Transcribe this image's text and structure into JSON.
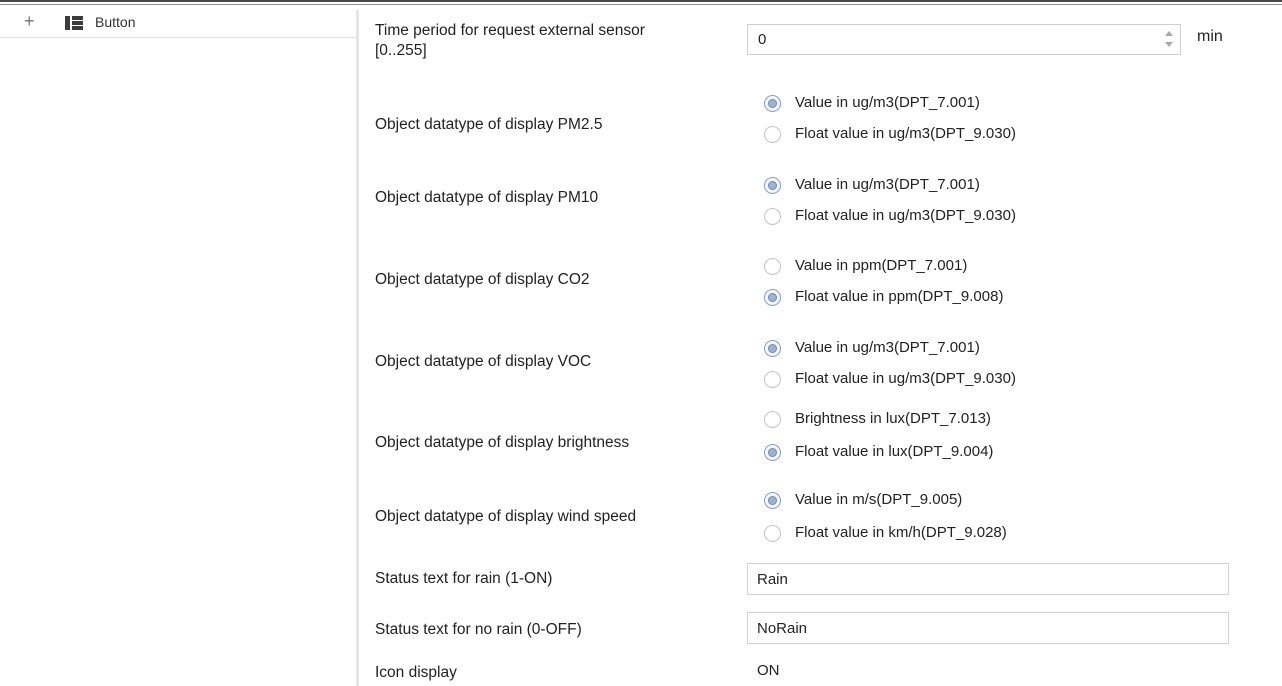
{
  "tree": {
    "expand_symbol": "+",
    "item_label": "Button",
    "item_icon": "panel-list-icon"
  },
  "request_period": {
    "label_line1": "Time period for request external sensor",
    "label_line2": "[0..255]",
    "value": "0",
    "unit": "min"
  },
  "radios": [
    {
      "label": "Object datatype of display PM2.5",
      "options": [
        "Value in ug/m3(DPT_7.001)",
        "Float value in ug/m3(DPT_9.030)"
      ],
      "selected": 0
    },
    {
      "label": "Object datatype of display PM10",
      "options": [
        "Value in ug/m3(DPT_7.001)",
        "Float value in ug/m3(DPT_9.030)"
      ],
      "selected": 0
    },
    {
      "label": "Object datatype of display CO2",
      "options": [
        "Value in ppm(DPT_7.001)",
        "Float value in ppm(DPT_9.008)"
      ],
      "selected": 1
    },
    {
      "label": "Object datatype of display VOC",
      "options": [
        "Value in ug/m3(DPT_7.001)",
        "Float value in ug/m3(DPT_9.030)"
      ],
      "selected": 0
    },
    {
      "label": "Object datatype of display brightness",
      "options": [
        "Brightness in lux(DPT_7.013)",
        "Float value in lux(DPT_9.004)"
      ],
      "selected": 1
    },
    {
      "label": "Object datatype of display wind speed",
      "options": [
        "Value in m/s(DPT_9.005)",
        "Float value in km/h(DPT_9.028)"
      ],
      "selected": 0
    }
  ],
  "rain_on": {
    "label": "Status text for rain (1-ON)",
    "value": "Rain"
  },
  "rain_off": {
    "label": "Status text for no rain (0-OFF)",
    "value": "NoRain"
  },
  "icon_display": {
    "label": "Icon display",
    "value": "ON"
  }
}
